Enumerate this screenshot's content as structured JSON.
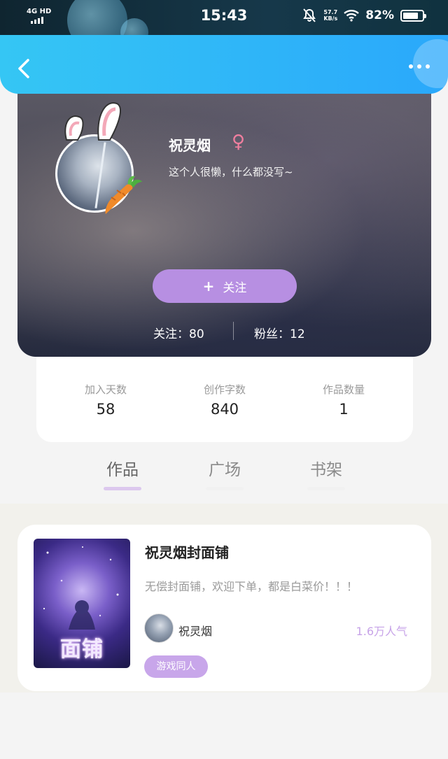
{
  "status_bar": {
    "network": "4G HD",
    "time": "15:43",
    "net_speed_value": "57.7",
    "net_speed_unit": "KB/s",
    "battery": "82%",
    "battery_level": 0.82
  },
  "profile": {
    "username": "祝灵烟",
    "gender_symbol": "♀",
    "bio": "这个人很懒，什么都没写~",
    "follow_plus": "+",
    "follow_label": "关注",
    "following_text": "关注：80",
    "fans_text": "粉丝：12"
  },
  "stats": [
    {
      "label": "加入天数",
      "value": "58"
    },
    {
      "label": "创作字数",
      "value": "840"
    },
    {
      "label": "作品数量",
      "value": "1"
    }
  ],
  "tabs": [
    {
      "label": "作品",
      "active": true
    },
    {
      "label": "广场",
      "active": false
    },
    {
      "label": "书架",
      "active": false
    }
  ],
  "works": [
    {
      "title": "祝灵烟封面铺",
      "description": "无偿封面铺，欢迎下单，都是白菜价！！！",
      "author": "祝灵烟",
      "popularity": "1.6万人气",
      "tag": "游戏同人",
      "cover_text": "面铺"
    }
  ],
  "colors": {
    "header_blue": "#2aa8fb",
    "accent_purple": "#b78fe2",
    "gender_pink": "#f07f9f"
  }
}
